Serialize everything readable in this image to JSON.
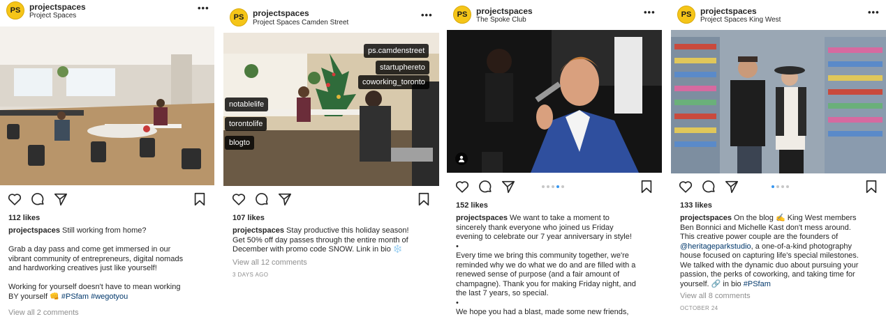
{
  "posts": [
    {
      "avatar_text": "PS",
      "username": "projectspaces",
      "location": "Project Spaces",
      "likes": "112 likes",
      "caption_user": "projectspaces",
      "caption_lines": [
        "Still working from home?",
        "",
        "Grab a day pass and come get immersed in our",
        "vibrant community of entrepreneurs, digital nomads",
        "and hardworking creatives just like yourself!",
        "",
        "Working for yourself doesn't have to mean working",
        "BY yourself 👊"
      ],
      "hashtags": [
        "#PSfam",
        "#wegotyou"
      ],
      "view_comments": "View all 2 comments",
      "colors": {
        "wall": "#dcd6cc",
        "floor": "#b8956a"
      }
    },
    {
      "avatar_text": "PS",
      "username": "projectspaces",
      "location": "Project Spaces Camden Street",
      "likes": "107 likes",
      "caption_user": "projectspaces",
      "caption_lines": [
        "Stay productive this holiday season!",
        "Get 50% off day passes through the entire month of",
        "December with promo code SNOW. Link in bio ❄️"
      ],
      "view_comments": "View all 12 comments",
      "timestamp": "3 DAYS AGO",
      "photo_tags": [
        "ps.camdenstreet",
        "startuphereto",
        "coworking_toronto",
        "notablelife",
        "torontolife",
        "blogto"
      ],
      "colors": {
        "wall": "#d8c9ac",
        "floor": "#6b5a45"
      }
    },
    {
      "avatar_text": "PS",
      "username": "projectspaces",
      "location": "The Spoke Club",
      "likes": "152 likes",
      "caption_user": "projectspaces",
      "caption_lines": [
        "We want to take a moment to",
        "sincerely thank everyone who joined us Friday",
        "evening to celebrate our 7 year anniversary in style!",
        "•",
        "Every time we bring this community together, we're",
        "reminded why we do what we do and are filled with a",
        "renewed sense of purpose (and a fair amount of",
        "champagne). Thank you for making Friday night, and",
        "the last 7 years, so special.",
        "•",
        "We hope you had a blast, made some new friends,"
      ],
      "carousel": {
        "count": 5,
        "active_index": 3
      },
      "colors": {
        "bg": "#141414",
        "suit": "#2f4f9e"
      }
    },
    {
      "avatar_text": "PS",
      "username": "projectspaces",
      "location": "Project Spaces King West",
      "likes": "133 likes",
      "caption_user": "projectspaces",
      "caption_first": "On the blog ✍️ King West members",
      "caption_lines": [
        "Ben Bonnici and Michelle Kast don't mess around.",
        "This creative power couple are the founders of"
      ],
      "mention": "@heritageparkstudio",
      "mention_tail": ", a one-of-a-kind photography",
      "caption_more": [
        "house focused on capturing life's special milestones.",
        "We talked with the dynamic duo about pursuing your",
        "passion, the perks of coworking, and taking time for"
      ],
      "caption_end": "yourself. 🔗 in bio",
      "hashtags": [
        "#PSfam"
      ],
      "view_comments": "View all 8 comments",
      "timestamp": "OCTOBER 24",
      "carousel": {
        "count": 4,
        "active_index": 0
      },
      "colors": {
        "wall": "#9aa7b4",
        "accent": "#c94a3d"
      }
    }
  ]
}
